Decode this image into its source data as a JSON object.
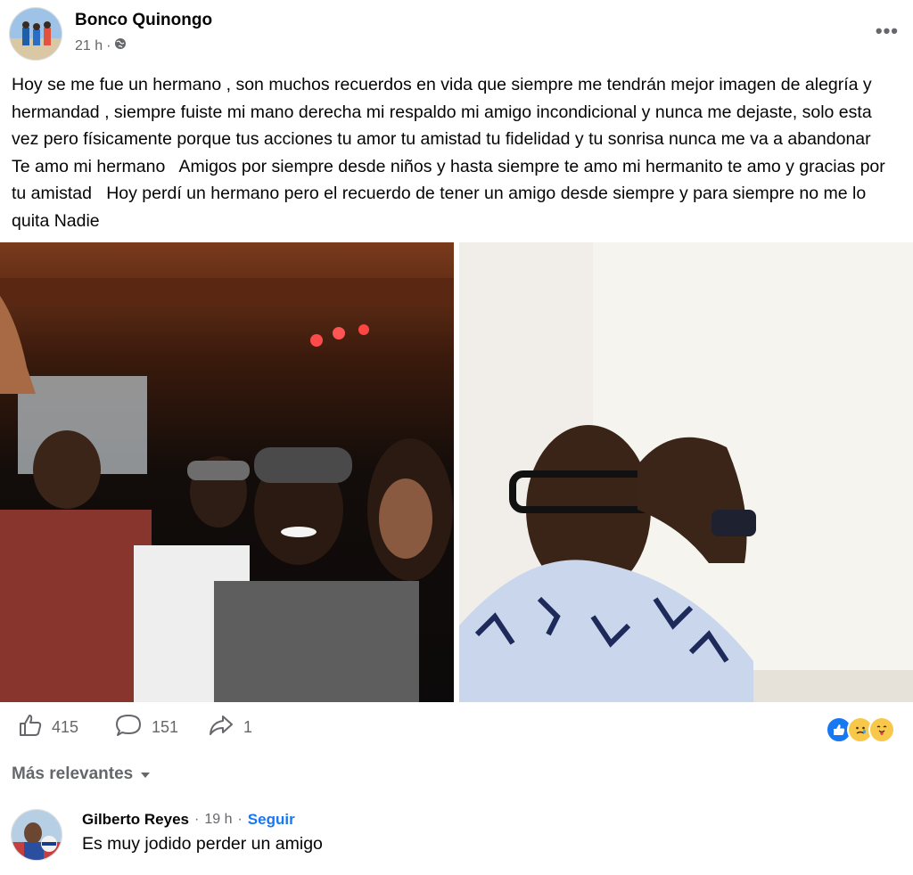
{
  "post": {
    "author": "Bonco Quinongo",
    "time": "21 h",
    "separator": "·",
    "privacy_icon": "globe-icon",
    "more_label": "•••",
    "text": "Hoy se me fue un hermano , son muchos recuerdos en vida que siempre me tendrán mejor imagen de alegría y hermandad , siempre fuiste mi mano derecha mi respaldo mi amigo incondicional y nunca me dejaste, solo esta vez pero físicamente porque tus acciones tu amor tu amistad tu fidelidad y tu sonrisa nunca me va a abandonar   Te amo mi hermano   Amigos por siempre desde niños y hasta siempre te amo mi hermanito te amo y gracias por tu amistad   Hoy perdí un hermano pero el recuerdo de tener un amigo desde siempre y para siempre no me lo quita Nadie"
  },
  "photos": [
    {
      "description": "Group selfie of four people in a dimly lit bar"
    },
    {
      "description": "Man with glasses saluting in front of a white wall"
    }
  ],
  "actions": {
    "likes": "415",
    "comments": "151",
    "shares": "1"
  },
  "reactions": [
    "like-icon",
    "care-icon",
    "hug-icon"
  ],
  "colors": {
    "accent": "#1877f2",
    "secondary_text": "#65676b"
  },
  "comments": {
    "sort_label": "Más relevantes",
    "items": [
      {
        "author": "Gilberto Reyes",
        "time": "19 h",
        "follow": "Seguir",
        "text": "Es muy jodido perder un amigo"
      }
    ]
  }
}
